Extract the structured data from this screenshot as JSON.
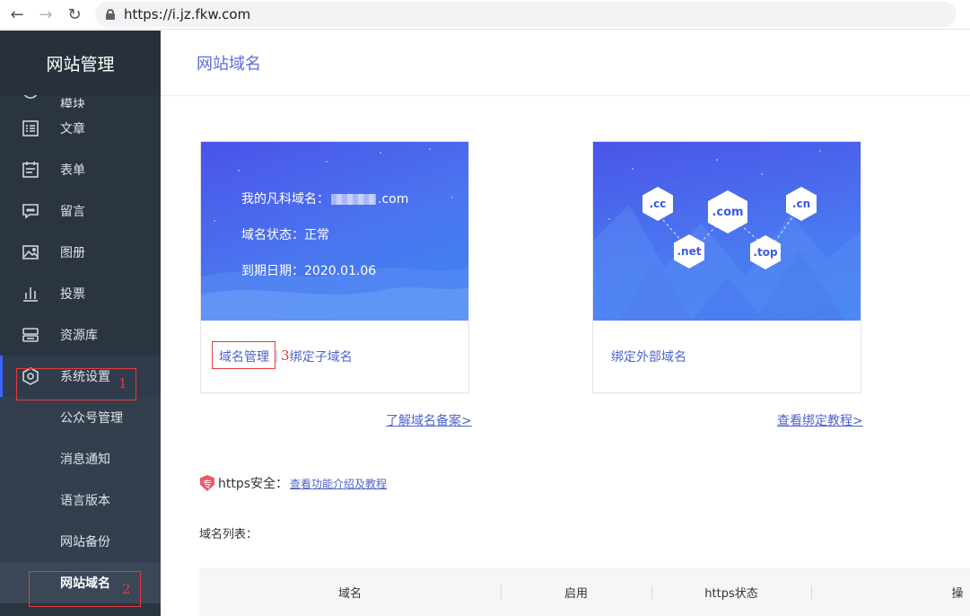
{
  "browser": {
    "url": "https://i.jz.fkw.com"
  },
  "sidebar": {
    "title": "网站管理",
    "partial_item": "模块",
    "items": [
      {
        "label": "文章",
        "icon": "article-icon"
      },
      {
        "label": "表单",
        "icon": "form-icon"
      },
      {
        "label": "留言",
        "icon": "message-icon"
      },
      {
        "label": "图册",
        "icon": "album-icon"
      },
      {
        "label": "投票",
        "icon": "vote-icon"
      },
      {
        "label": "资源库",
        "icon": "resource-icon"
      }
    ],
    "active_parent": {
      "label": "系统设置",
      "icon": "settings-icon",
      "annotation": "1"
    },
    "sub_items": [
      {
        "label": "公众号管理"
      },
      {
        "label": "消息通知"
      },
      {
        "label": "语言版本"
      },
      {
        "label": "网站备份"
      },
      {
        "label": "网站域名",
        "current": true,
        "annotation": "2"
      }
    ]
  },
  "main": {
    "title": "网站域名",
    "card1": {
      "domain_label": "我的凡科域名：",
      "domain_suffix": ".com",
      "status": "域名状态：正常",
      "expiry": "到期日期：2020.01.06",
      "manage_link": "域名管理",
      "manage_annotation": "3",
      "bind_sub_link": "绑定子域名",
      "learn_link": "了解域名备案>"
    },
    "card2": {
      "hex_labels": [
        ".cc",
        ".com",
        ".cn",
        ".net",
        ".top"
      ],
      "bind_external_link": "绑定外部域名",
      "tutorial_link": "查看绑定教程>"
    },
    "https": {
      "badge": "专",
      "label": "https安全：",
      "link": "查看功能介绍及教程"
    },
    "list_label": "域名列表：",
    "table_headers": [
      "域名",
      "启用",
      "https状态",
      "操"
    ]
  },
  "colors": {
    "sidebar_bg": "#2b3541",
    "accent": "#4f63c9",
    "annotation_red": "#e33b3b"
  }
}
